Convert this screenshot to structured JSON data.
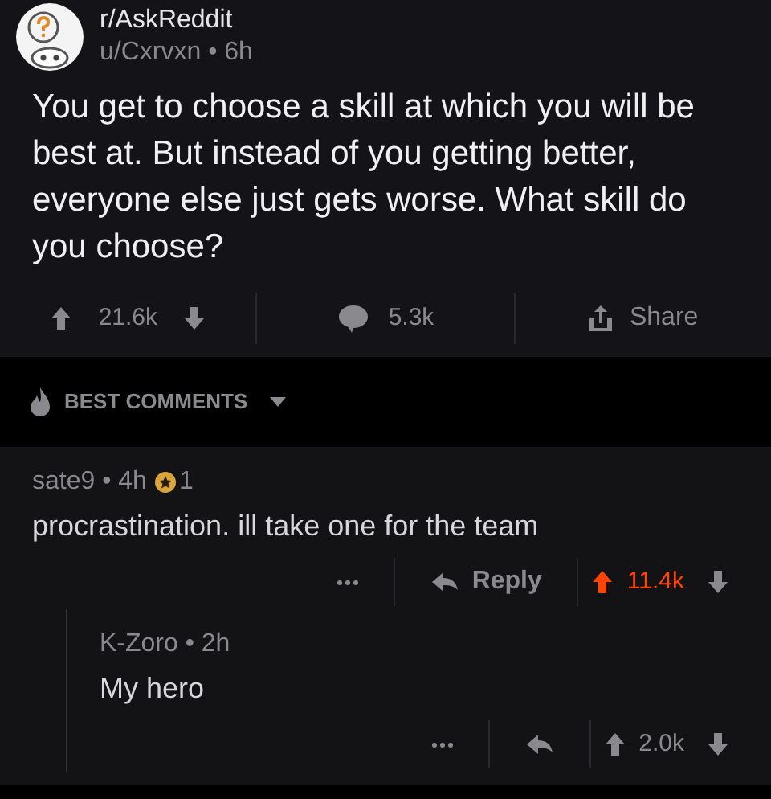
{
  "post": {
    "subreddit": "r/AskReddit",
    "meta": "u/Cxrvxn • 6h",
    "title": "You get to choose a skill at which you will be best at. But instead of you getting better, everyone else just gets worse. What skill do you choose?",
    "score": "21.6k",
    "comments": "5.3k",
    "share": "Share"
  },
  "sort": {
    "label": "BEST COMMENTS"
  },
  "comments": [
    {
      "meta": "sate9 • 4h",
      "awards": "1",
      "body": "procrastination. ill take one for the team",
      "reply_label": "Reply",
      "score": "11.4k",
      "upvoted": true,
      "children": [
        {
          "meta": "K-Zoro • 2h",
          "body": "My hero",
          "score": "2.0k",
          "upvoted": false
        }
      ]
    }
  ]
}
